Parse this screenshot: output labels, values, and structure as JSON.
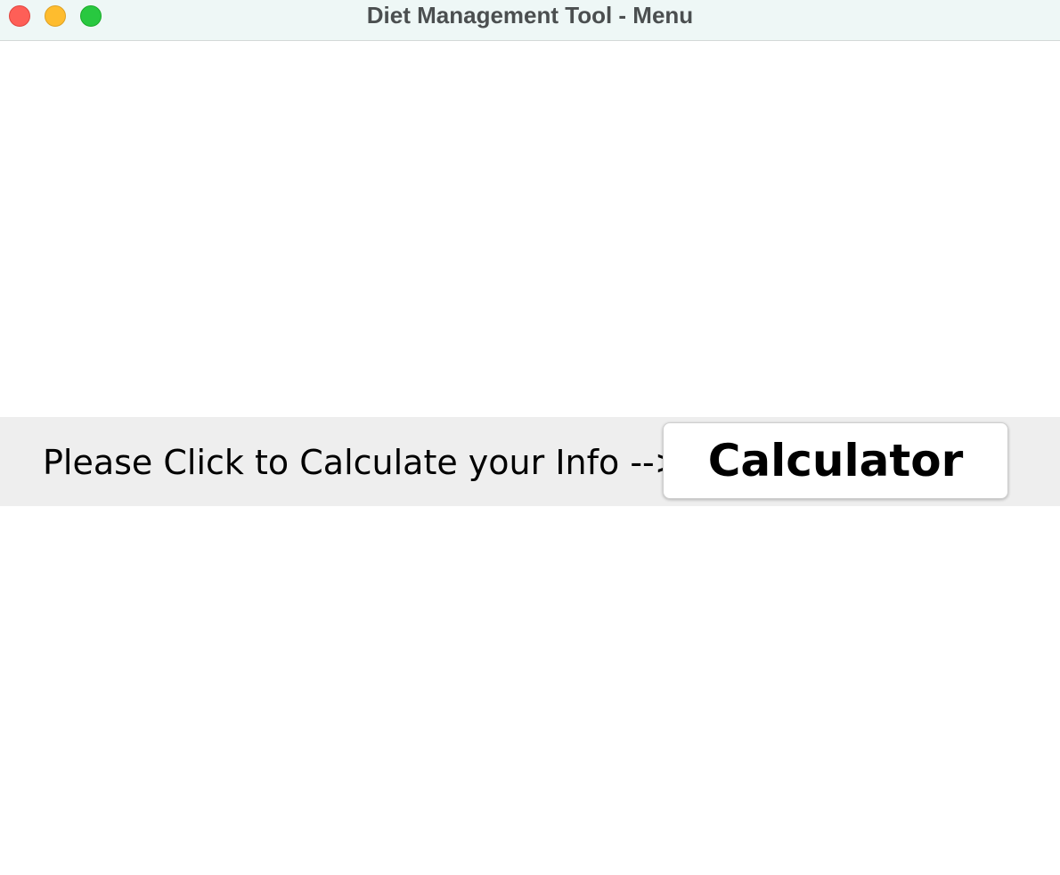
{
  "window": {
    "title": "Diet Management Tool - Menu",
    "controls": [
      "close",
      "minimize",
      "zoom"
    ]
  },
  "main": {
    "prompt": "Please Click to Calculate your Info -->",
    "calculator_button_label": "Calculator"
  },
  "colors": {
    "titlebar_bg": "#eef7f6",
    "panel_bg": "#eeeeee",
    "close": "#fe5f57",
    "minimize": "#febc2e",
    "zoom": "#28c840"
  }
}
